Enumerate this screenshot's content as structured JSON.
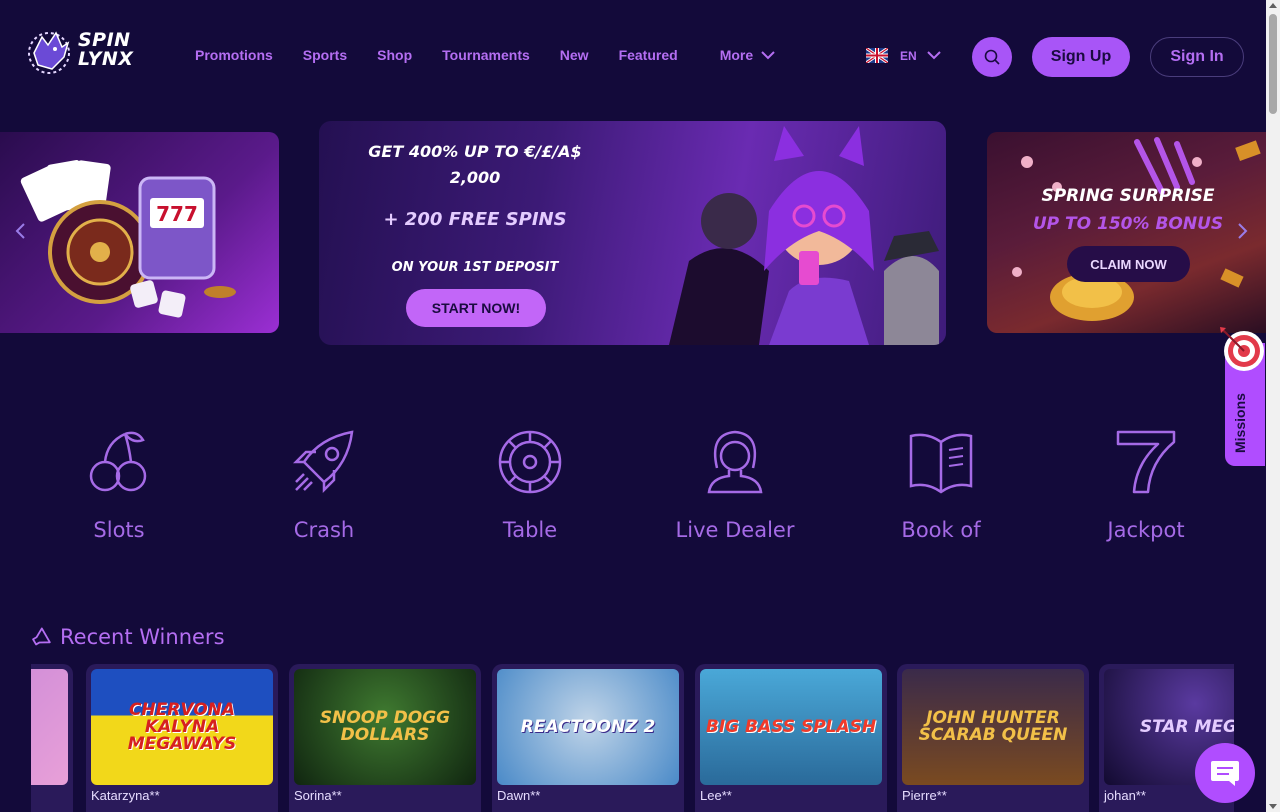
{
  "brand": {
    "line1": "SPIN",
    "line2": "LYNX"
  },
  "nav": {
    "items": [
      "Promotions",
      "Sports",
      "Shop",
      "Tournaments",
      "New",
      "Featured"
    ],
    "more": "More"
  },
  "language": {
    "code": "EN"
  },
  "auth": {
    "signup": "Sign Up",
    "signin": "Sign In"
  },
  "banners": {
    "center": {
      "line1": "GET 400% UP TO €/£/A$",
      "line1b": "2,000",
      "line2": "+ 200 FREE SPINS",
      "line3": "ON YOUR 1ST DEPOSIT",
      "cta": "START NOW!"
    },
    "right": {
      "line1": "SPRING SURPRISE",
      "line2": "UP TO 150% BONUS",
      "cta": "CLAIM NOW"
    }
  },
  "missions": {
    "label": "Missions"
  },
  "categories": [
    "Slots",
    "Crash",
    "Table",
    "Live Dealer",
    "Book of",
    "Jackpot"
  ],
  "recent_winners": {
    "title": "Recent Winners",
    "cards": [
      {
        "game": "CHERVONA KALYNA MEGAWAYS",
        "player": "Katarzyna**"
      },
      {
        "game": "SNOOP DOGG DOLLARS",
        "player": "Sorina**"
      },
      {
        "game": "REACTOONZ 2",
        "player": "Dawn**"
      },
      {
        "game": "BIG BASS SPLASH",
        "player": "Lee**"
      },
      {
        "game": "JOHN HUNTER SCARAB QUEEN",
        "player": "Pierre**"
      },
      {
        "game": "STAR MEGA",
        "player": "johan**"
      }
    ]
  },
  "colors": {
    "bg": "#130a3a",
    "accent": "#a855f7",
    "text": "#b46ef2"
  }
}
